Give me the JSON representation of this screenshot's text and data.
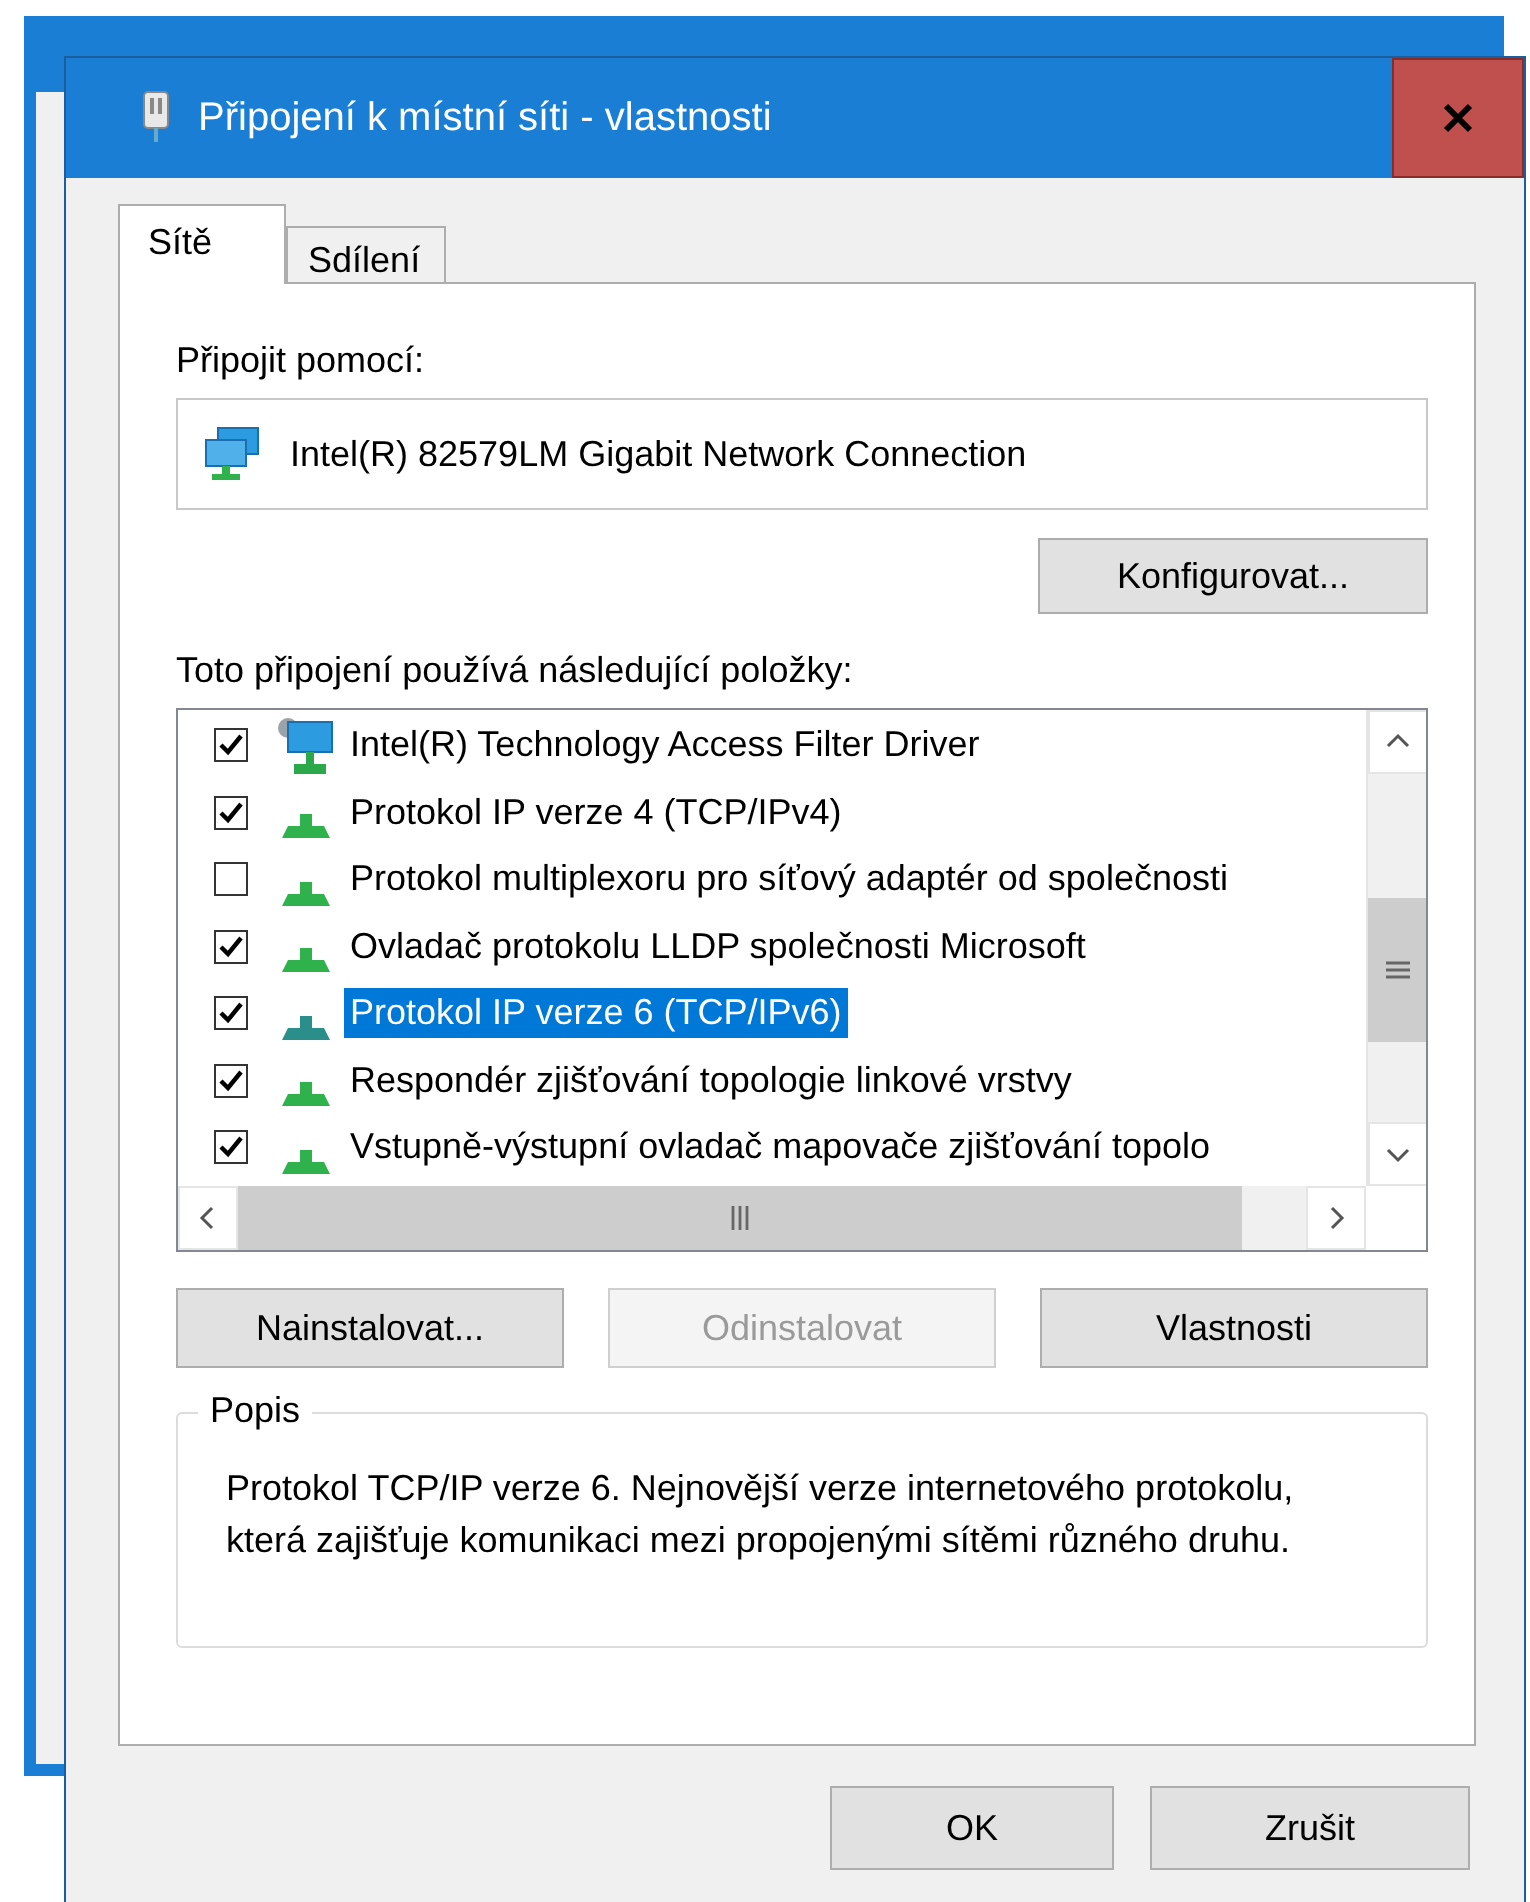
{
  "dialog": {
    "title": "Připojení k místní síti - vlastnosti"
  },
  "tabs": [
    {
      "label": "Sítě",
      "selected": true
    },
    {
      "label": "Sdílení",
      "selected": false
    }
  ],
  "connect_using": {
    "label": "Připojit pomocí:",
    "adapter": "Intel(R) 82579LM Gigabit Network Connection"
  },
  "configure_button": "Konfigurovat...",
  "items_label": "Toto připojení používá následující položky:",
  "items": [
    {
      "kind": "adapter",
      "label": "Intel(R) Technology Access Filter Driver",
      "checked": true,
      "selected": false
    },
    {
      "kind": "protocol",
      "label": "Protokol IP verze 4 (TCP/IPv4)",
      "checked": true,
      "selected": false
    },
    {
      "kind": "protocol",
      "label": "Protokol multiplexoru pro síťový adaptér od společnosti",
      "checked": false,
      "selected": false
    },
    {
      "kind": "protocol",
      "label": "Ovladač protokolu LLDP společnosti Microsoft",
      "checked": true,
      "selected": false
    },
    {
      "kind": "protocol",
      "label": "Protokol IP verze 6 (TCP/IPv6)",
      "checked": true,
      "selected": true
    },
    {
      "kind": "protocol",
      "label": "Respondér zjišťování topologie linkové vrstvy",
      "checked": true,
      "selected": false
    },
    {
      "kind": "protocol",
      "label": "Vstupně-výstupní ovladač mapovače zjišťování topolo",
      "checked": true,
      "selected": false
    }
  ],
  "item_buttons": [
    {
      "label": "Nainstalovat...",
      "disabled": false
    },
    {
      "label": "Odinstalovat",
      "disabled": true
    },
    {
      "label": "Vlastnosti",
      "disabled": false
    }
  ],
  "description": {
    "title": "Popis",
    "text": "Protokol TCP/IP verze 6. Nejnovější verze internetového protokolu, která zajišťuje komunikaci mezi propojenými sítěmi různého druhu."
  },
  "footer_buttons": [
    "OK",
    "Zrušit"
  ]
}
